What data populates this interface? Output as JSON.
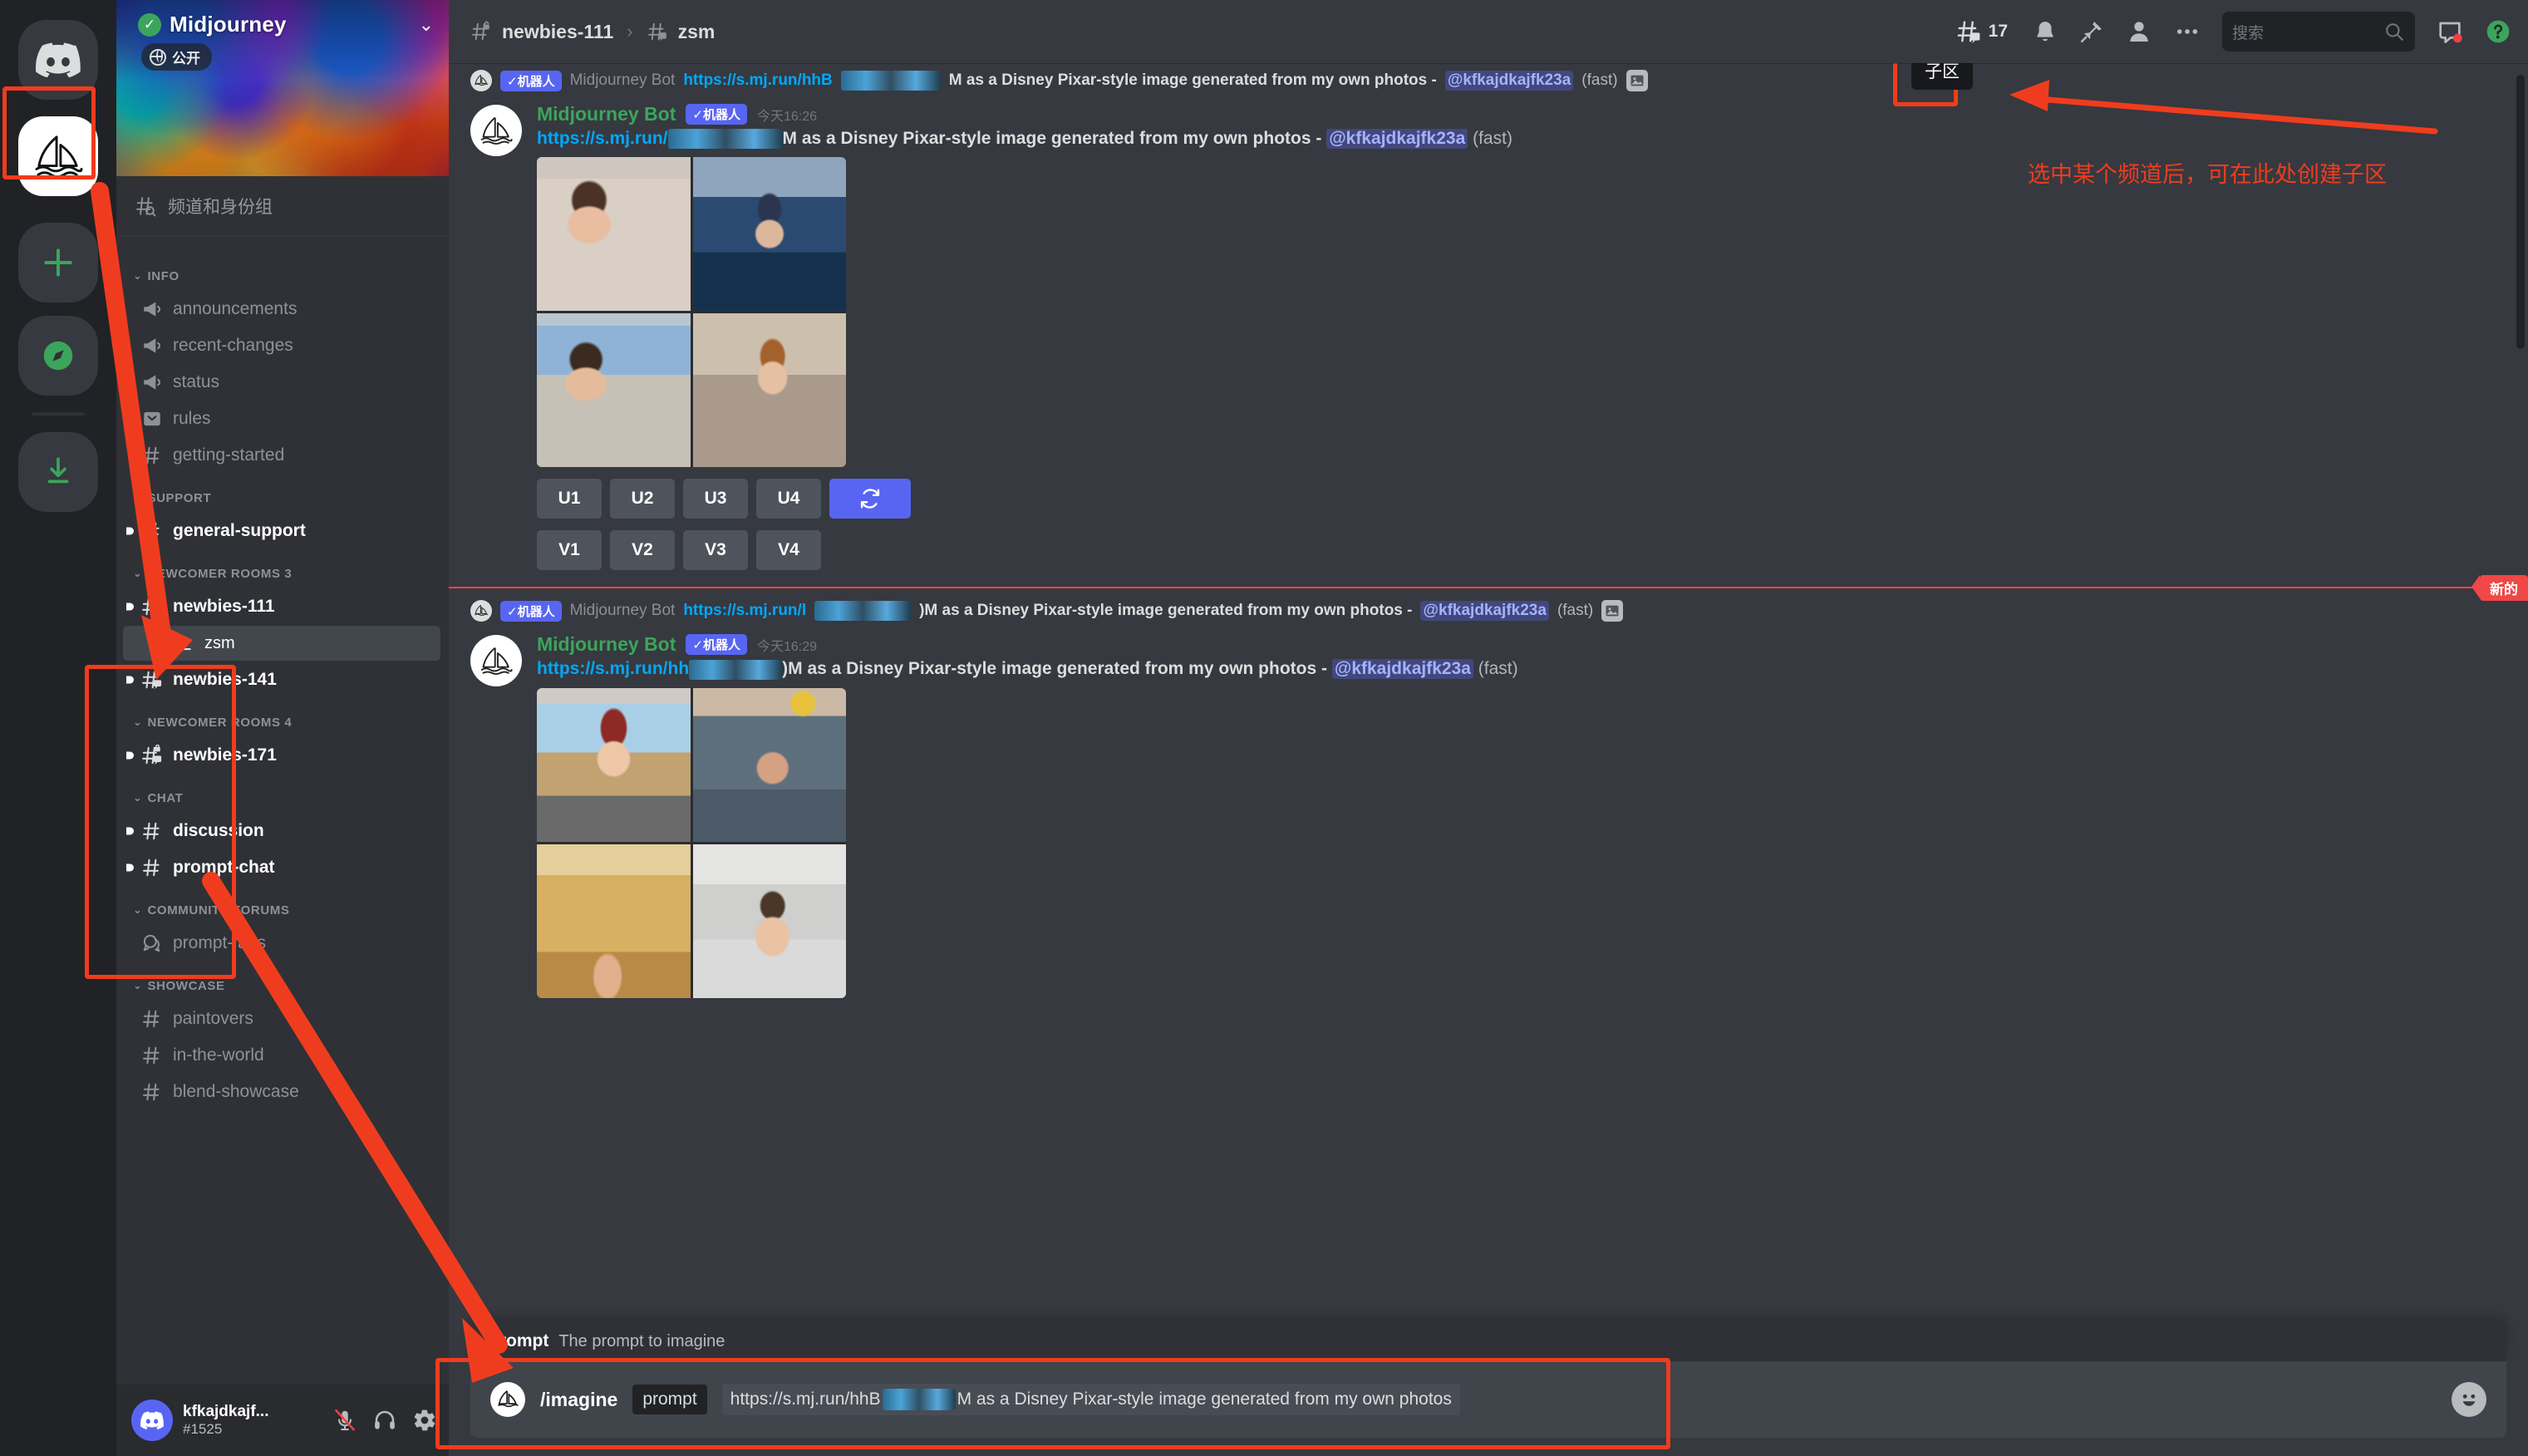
{
  "server": {
    "name": "Midjourney",
    "privacy_label": "公开",
    "browse_channels_label": "频道和身份组"
  },
  "sidebar": {
    "categories": [
      {
        "name": "INFO",
        "channels": [
          {
            "label": "announcements",
            "icon": "announcement-icon",
            "unread": false,
            "state": "muted"
          },
          {
            "label": "recent-changes",
            "icon": "announcement-icon",
            "unread": false,
            "state": "muted"
          },
          {
            "label": "status",
            "icon": "announcement-icon",
            "unread": false,
            "state": "muted"
          },
          {
            "label": "rules",
            "icon": "rules-icon",
            "unread": false,
            "state": "muted"
          },
          {
            "label": "getting-started",
            "icon": "hash-icon",
            "unread": false,
            "state": "muted"
          }
        ]
      },
      {
        "name": "SUPPORT",
        "channels": [
          {
            "label": "general-support",
            "icon": "hash-icon",
            "unread": true,
            "state": "unread"
          }
        ]
      },
      {
        "name": "NEWCOMER ROOMS 3",
        "channels": [
          {
            "label": "newbies-111",
            "icon": "hash-thread-lock-icon",
            "unread": true,
            "state": "unread"
          },
          {
            "label": "zsm",
            "icon": "thread-branch-icon",
            "unread": false,
            "state": "active",
            "is_thread": true
          },
          {
            "label": "newbies-141",
            "icon": "hash-thread-lock-icon",
            "unread": true,
            "state": "unread"
          }
        ]
      },
      {
        "name": "NEWCOMER ROOMS 4",
        "channels": [
          {
            "label": "newbies-171",
            "icon": "hash-thread-lock-icon",
            "unread": true,
            "state": "unread"
          }
        ]
      },
      {
        "name": "CHAT",
        "channels": [
          {
            "label": "discussion",
            "icon": "hash-icon",
            "unread": true,
            "state": "unread"
          },
          {
            "label": "prompt-chat",
            "icon": "hash-icon",
            "unread": true,
            "state": "unread"
          }
        ]
      },
      {
        "name": "COMMUNITY FORUMS",
        "channels": [
          {
            "label": "prompt-faqs",
            "icon": "forum-icon",
            "unread": false,
            "state": "muted"
          }
        ]
      },
      {
        "name": "SHOWCASE",
        "channels": [
          {
            "label": "paintovers",
            "icon": "hash-icon",
            "unread": false,
            "state": "muted"
          },
          {
            "label": "in-the-world",
            "icon": "hash-icon",
            "unread": false,
            "state": "muted"
          },
          {
            "label": "blend-showcase",
            "icon": "hash-icon",
            "unread": false,
            "state": "muted"
          }
        ]
      }
    ]
  },
  "user_panel": {
    "username": "kfkajdkajf...",
    "discriminator": "#1525",
    "icons": [
      "mic-muted-icon",
      "headphones-icon",
      "gear-icon"
    ]
  },
  "header": {
    "breadcrumb": [
      {
        "label": "newbies-111",
        "icon": "hash-lock-icon"
      },
      {
        "label": "zsm",
        "icon": "hash-thread-icon"
      }
    ],
    "separator": "›",
    "thread_count": "17",
    "tools": [
      "threads-icon",
      "bell-icon",
      "pin-icon",
      "members-icon",
      "more-icon"
    ],
    "search_placeholder": "搜索",
    "right_icons": [
      "inbox-icon",
      "help-icon"
    ]
  },
  "tooltip": {
    "threads_label": "子区"
  },
  "annotations": {
    "create_thread_note": "选中某个频道后，可在此处创建子区"
  },
  "messages": [
    {
      "compact_preview": {
        "bot_tag": "✓机器人",
        "bot_name": "Midjourney Bot",
        "link": "https://s.mj.run/hhB",
        "redacted": true,
        "text": "M as a Disney Pixar-style image generated from my own photos - ",
        "mention": "@kfkajdkajfk23a",
        "speed": "(fast)"
      },
      "author": "Midjourney Bot",
      "bot_tag": "✓机器人",
      "timestamp": "今天16:26",
      "link": "https://s.mj.run/",
      "text": "M as a Disney Pixar-style image generated from my own photos - ",
      "mention": "@kfkajdkajfk23a",
      "speed": "(fast)",
      "upscale_buttons": [
        "U1",
        "U2",
        "U3",
        "U4"
      ],
      "reroll_button": "reroll-icon",
      "variation_buttons": [
        "V1",
        "V2",
        "V3",
        "V4"
      ],
      "has_buttons": true
    },
    {
      "compact_preview": {
        "bot_tag": "✓机器人",
        "bot_name": "Midjourney Bot",
        "link": "https://s.mj.run/l",
        "redacted": true,
        "text": ")M as a Disney Pixar-style image generated from my own photos - ",
        "mention": "@kfkajdkajfk23a",
        "speed": "(fast)"
      },
      "author": "Midjourney Bot",
      "bot_tag": "✓机器人",
      "timestamp": "今天16:29",
      "link": "https://s.mj.run/hh",
      "text": ")M as a Disney Pixar-style image generated from my own photos - ",
      "mention": "@kfkajdkajfk23a",
      "speed": "(fast)",
      "has_buttons": false
    }
  ],
  "new_messages_divider": {
    "label": "新的"
  },
  "composer": {
    "hint_key": "prompt",
    "hint_desc": "The prompt to imagine",
    "command": "/imagine",
    "arg_name": "prompt",
    "arg_value_prefix": "https://s.mj.run/hhB",
    "arg_value_suffix": "M as a Disney Pixar-style image generated from my own photos",
    "emoji_icon": "emoji-icon"
  },
  "colors": {
    "accent_blurple": "#5865f2",
    "annotation_red": "#f03c1e",
    "online_green": "#3ba55c",
    "link_blue": "#00a8fc",
    "new_red": "#f04747",
    "sidebar_bg": "#2f3136",
    "rail_bg": "#202225",
    "main_bg": "#36393f"
  }
}
